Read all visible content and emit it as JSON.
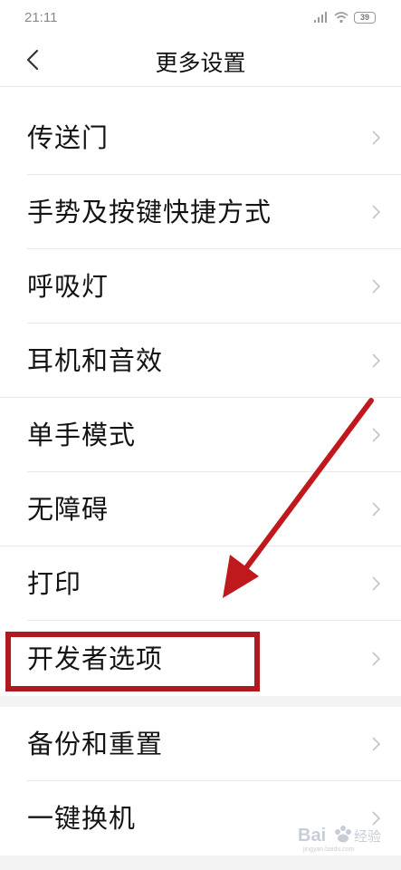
{
  "status_bar": {
    "time": "21:11",
    "battery": "39"
  },
  "header": {
    "title": "更多设置",
    "back_icon": "chevron-left-icon"
  },
  "menu": {
    "items": [
      {
        "label": "传送门"
      },
      {
        "label": "手势及按键快捷方式"
      },
      {
        "label": "呼吸灯"
      },
      {
        "label": "耳机和音效"
      },
      {
        "label": "单手模式"
      },
      {
        "label": "无障碍"
      },
      {
        "label": "打印"
      },
      {
        "label": "开发者选项"
      },
      {
        "label": "备份和重置"
      },
      {
        "label": "一键换机"
      }
    ],
    "chevron_icon": "chevron-right-icon"
  },
  "annotation": {
    "highlight_color": "#b0191d",
    "arrow_color": "#c0191d",
    "highlighted_item": "开发者选项"
  },
  "watermark": {
    "text": "Bai经验",
    "sub_text": "jingyan.baidu.com"
  }
}
